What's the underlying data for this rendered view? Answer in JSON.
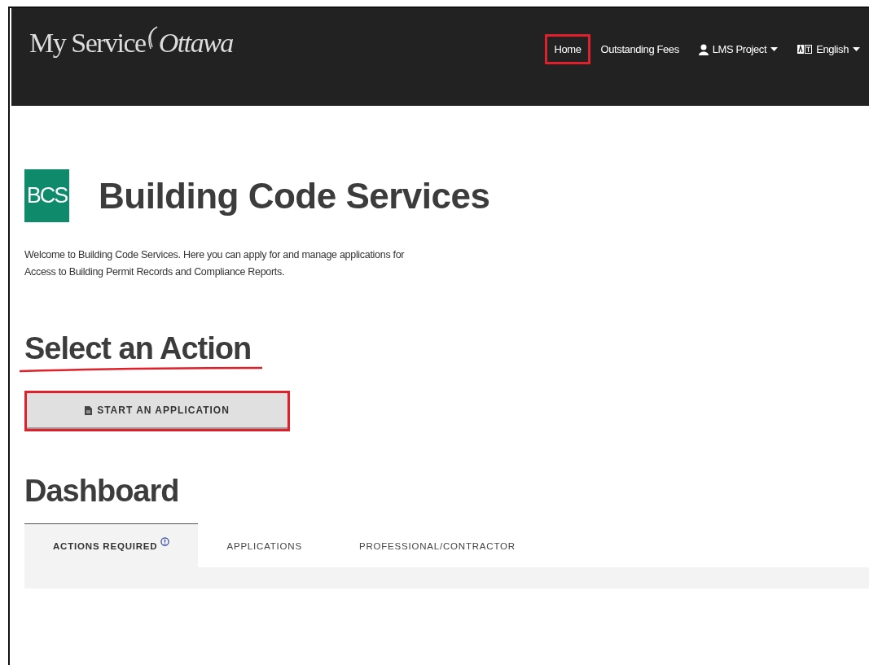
{
  "header": {
    "logo": {
      "first": "My Service",
      "second": "Ottawa"
    },
    "nav": [
      {
        "label": "Home",
        "kind": "link",
        "highlighted": true
      },
      {
        "label": "Outstanding Fees",
        "kind": "link",
        "highlighted": false
      },
      {
        "label": "LMS Project",
        "kind": "user-menu",
        "highlighted": false
      },
      {
        "label": "English",
        "kind": "language-menu",
        "highlighted": false
      }
    ]
  },
  "page": {
    "badge": "BCS",
    "title": "Building Code Services",
    "intro": "Welcome to Building Code Services. Here you can apply for and manage applications for Access to Building Permit Records and Compliance Reports.",
    "action_heading": {
      "text": "Select an Action",
      "underlined": true
    },
    "action_button": {
      "label": "START AN APPLICATION",
      "highlighted": true
    },
    "dashboard_heading": "Dashboard",
    "tabs": [
      {
        "label": "ACTIONS REQUIRED",
        "selected": true,
        "alert": true
      },
      {
        "label": "APPLICATIONS",
        "selected": false,
        "alert": false
      },
      {
        "label": "PROFESSIONAL/CONTRACTOR",
        "selected": false,
        "alert": false
      }
    ]
  }
}
